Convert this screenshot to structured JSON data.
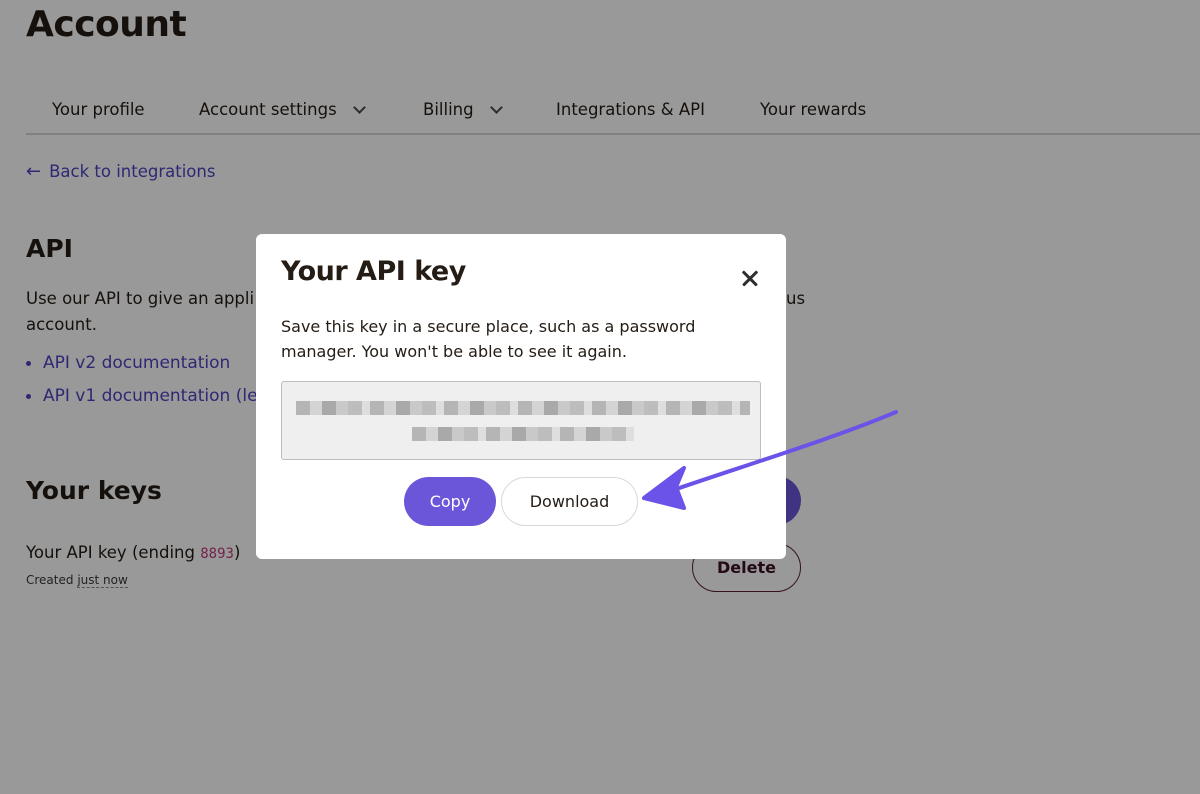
{
  "page": {
    "title": "Account"
  },
  "tabs": [
    {
      "label": "Your profile",
      "has_dropdown": false
    },
    {
      "label": "Account settings",
      "has_dropdown": true
    },
    {
      "label": "Billing",
      "has_dropdown": true
    },
    {
      "label": "Integrations & API",
      "has_dropdown": false
    },
    {
      "label": "Your rewards",
      "has_dropdown": false
    }
  ],
  "back_link": {
    "icon": "arrow-left-icon",
    "label": "Back to integrations"
  },
  "api_section": {
    "title": "API",
    "description_start": "Use our API to give an appli",
    "description_end": "us",
    "description_line2": "account.",
    "docs": [
      {
        "label": "API v2 documentation"
      },
      {
        "label": "API v1 documentation (leg"
      }
    ]
  },
  "keys_section": {
    "title": "Your keys",
    "key_label_prefix": "Your API key (ending ",
    "key_suffix": "8893",
    "key_label_suffix": ")",
    "created_prefix": "Created ",
    "created_when": "just now",
    "delete_label": "Delete"
  },
  "modal": {
    "title": "Your API key",
    "description": "Save this key in a secure place, such as a password manager. You won't be able to see it again.",
    "key_value_visible": false,
    "copy_label": "Copy",
    "download_label": "Download"
  },
  "colors": {
    "accent": "#6b56d9",
    "link": "#4e44c2",
    "annotation_arrow": "#6b52e8",
    "key_code": "#c0397a",
    "overlay": "rgba(0,0,0,0.4)"
  }
}
